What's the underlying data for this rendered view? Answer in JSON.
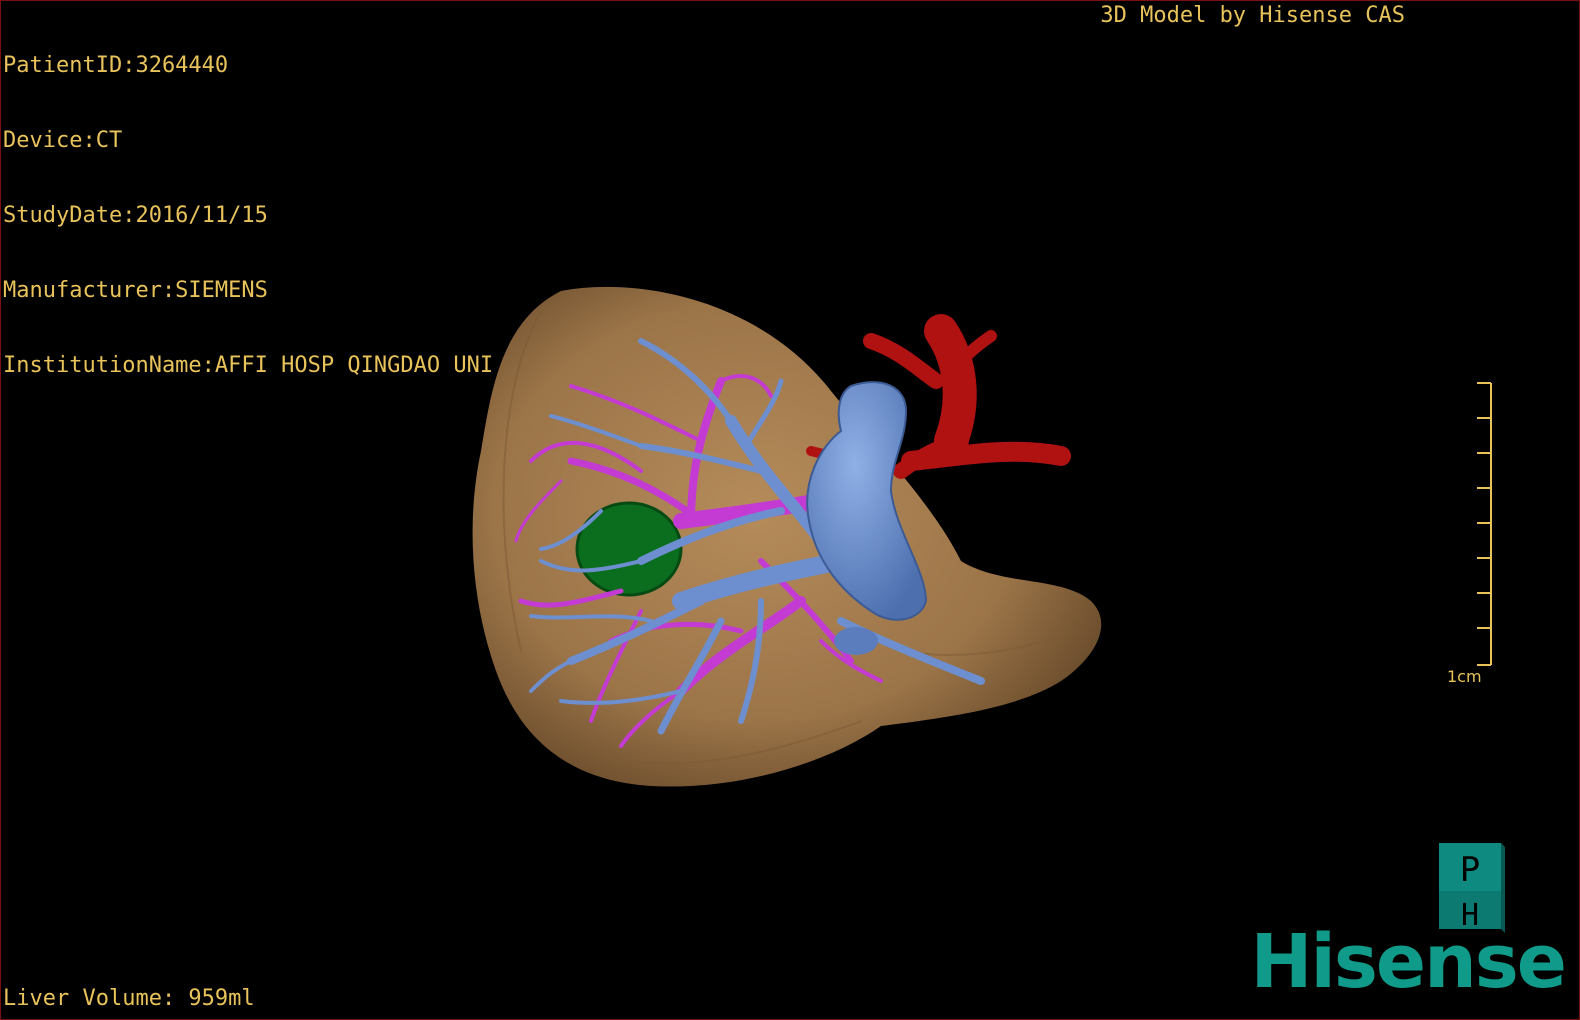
{
  "patient": {
    "id_line": "PatientID:3264440",
    "device_line": "Device:CT",
    "study_date_line": "StudyDate:2016/11/15",
    "manufacturer_line": "Manufacturer:SIEMENS",
    "institution_line": "InstitutionName:AFFI HOSP QINGDAO UNI"
  },
  "credit": "3D Model by Hisense CAS",
  "liver_volume": "Liver Volume: 959ml",
  "scale": {
    "label": "1cm"
  },
  "orientation_cube": {
    "top_letter": "P",
    "bottom_letter": "H"
  },
  "brand": "Hisense",
  "colors": {
    "overlay_text": "#e8c25a",
    "liver": "#a07a4e",
    "portal_vein": "#6d8fcf",
    "hepatic_vein": "#c43bd4",
    "artery": "#b01212",
    "lesion": "#0b6e1e",
    "brand": "#0f9a8a"
  },
  "structures": [
    {
      "name": "liver",
      "icon": "liver-icon"
    },
    {
      "name": "portal-vein",
      "icon": "vein-icon"
    },
    {
      "name": "hepatic-vein",
      "icon": "vein-icon"
    },
    {
      "name": "artery",
      "icon": "artery-icon"
    },
    {
      "name": "lesion",
      "icon": "lesion-icon"
    }
  ]
}
